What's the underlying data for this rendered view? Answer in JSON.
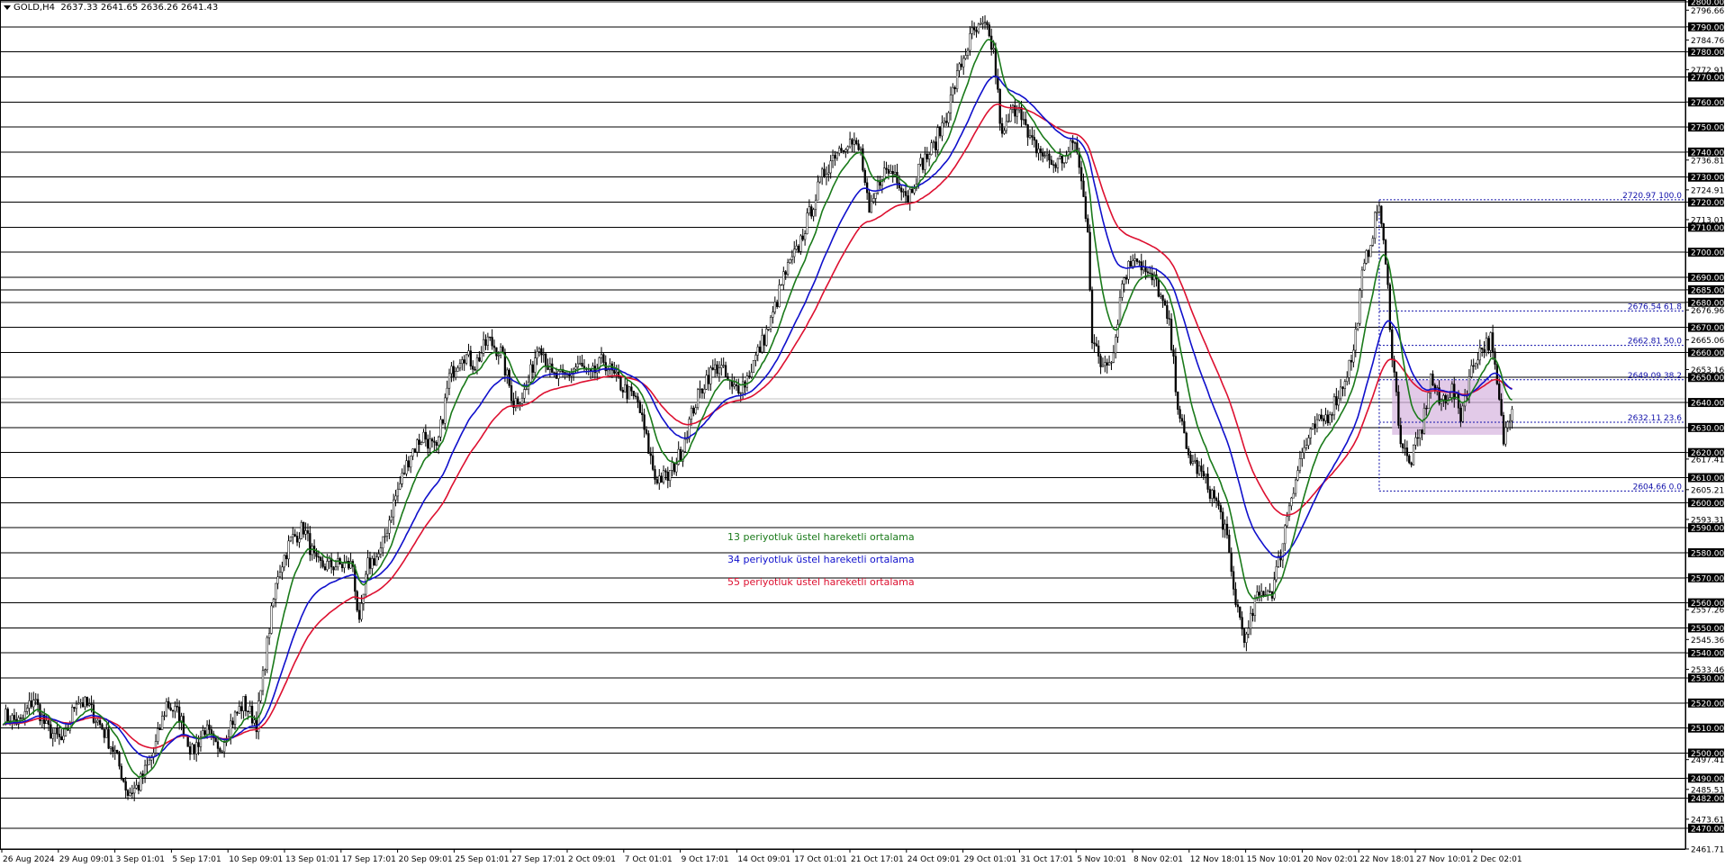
{
  "header": {
    "symbol": "GOLD,H4",
    "ohlc": "2637.33 2641.65 2636.26 2641.43"
  },
  "legend": [
    {
      "label": "13 periyotluk üstel hareketli ortalama",
      "color": "#1a7a1a"
    },
    {
      "label": "34 periyotluk üstel hareketli ortalama",
      "color": "#1010cc"
    },
    {
      "label": "55 periyotluk üstel hareketli ortalama",
      "color": "#dd1030"
    }
  ],
  "chart_data": {
    "type": "line",
    "title": "",
    "ylim": [
      2461.71,
      2800.0
    ],
    "grid": false,
    "x_ticks": [
      "26 Aug 2024",
      "29 Aug 09:01",
      "3 Sep 01:01",
      "5 Sep 17:01",
      "10 Sep 09:01",
      "13 Sep 01:01",
      "17 Sep 17:01",
      "20 Sep 09:01",
      "25 Sep 01:01",
      "27 Sep 17:01",
      "2 Oct 09:01",
      "7 Oct 01:01",
      "9 Oct 17:01",
      "14 Oct 09:01",
      "17 Oct 01:01",
      "21 Oct 17:01",
      "24 Oct 09:01",
      "29 Oct 01:01",
      "31 Oct 17:01",
      "5 Nov 10:01",
      "8 Nov 02:01",
      "12 Nov 18:01",
      "15 Nov 10:01",
      "20 Nov 02:01",
      "22 Nov 18:01",
      "27 Nov 10:01",
      "2 Dec 02:01"
    ],
    "horizontal_levels": [
      2800,
      2790,
      2780,
      2770,
      2760,
      2750,
      2740,
      2730,
      2720,
      2710,
      2700,
      2690,
      2685,
      2680,
      2670,
      2660,
      2650,
      2640,
      2630,
      2620,
      2610,
      2600,
      2590,
      2580,
      2570,
      2560,
      2550,
      2540,
      2530,
      2520,
      2510,
      2500,
      2490,
      2482,
      2470
    ],
    "y_tick_labels": [
      "2800.00",
      "2796.66",
      "2790.00",
      "2784.76",
      "2780.00",
      "2772.91",
      "2770.00",
      "2760.00",
      "2750.00",
      "2740.00",
      "2736.81",
      "2730.00",
      "2724.91",
      "2720.00",
      "2713.01",
      "2710.00",
      "2700.00",
      "2690.00",
      "2685.00",
      "2680.00",
      "2676.96",
      "2670.00",
      "2665.06",
      "2660.00",
      "2653.16",
      "2650.00",
      "2640.00",
      "2630.00",
      "2620.00",
      "2617.41",
      "2610.00",
      "2605.21",
      "2600.00",
      "2593.31",
      "2590.00",
      "2580.00",
      "2570.00",
      "2560.00",
      "2557.26",
      "2550.00",
      "2545.36",
      "2540.00",
      "2533.46",
      "2530.00",
      "2520.00",
      "2510.00",
      "2500.00",
      "2497.41",
      "2490.00",
      "2485.51",
      "2482.00",
      "2473.61",
      "2470.00",
      "2461.71"
    ],
    "highlighted_y_labels": [
      "2800.00",
      "2790.00",
      "2780.00",
      "2770.00",
      "2760.00",
      "2750.00",
      "2740.00",
      "2730.00",
      "2720.00",
      "2710.00",
      "2700.00",
      "2690.00",
      "2685.00",
      "2680.00",
      "2670.00",
      "2660.00",
      "2650.00",
      "2640.00",
      "2630.00",
      "2620.00",
      "2610.00",
      "2600.00",
      "2590.00",
      "2580.00",
      "2570.00",
      "2560.00",
      "2550.00",
      "2540.00",
      "2530.00",
      "2520.00",
      "2510.00",
      "2500.00",
      "2490.00",
      "2482.00",
      "2470.00"
    ],
    "current_price": 2641.43,
    "fibonacci": [
      {
        "label": "2720.97 100.0",
        "value": 2720.97
      },
      {
        "label": "2676.54 61.8",
        "value": 2676.54
      },
      {
        "label": "2662.81 50.0",
        "value": 2662.81
      },
      {
        "label": "2649.09 38.2",
        "value": 2649.09
      },
      {
        "label": "2632.11 23.6",
        "value": 2632.11
      },
      {
        "label": "2604.66 0.0",
        "value": 2604.66
      }
    ],
    "price_anchors": [
      [
        0,
        2515
      ],
      [
        8,
        2512
      ],
      [
        14,
        2522
      ],
      [
        20,
        2510
      ],
      [
        28,
        2504
      ],
      [
        34,
        2522
      ],
      [
        40,
        2518
      ],
      [
        46,
        2510
      ],
      [
        52,
        2500
      ],
      [
        58,
        2484
      ],
      [
        63,
        2487
      ],
      [
        70,
        2500
      ],
      [
        76,
        2520
      ],
      [
        82,
        2515
      ],
      [
        88,
        2500
      ],
      [
        94,
        2510
      ],
      [
        100,
        2500
      ],
      [
        106,
        2512
      ],
      [
        112,
        2520
      ],
      [
        118,
        2512
      ],
      [
        121,
        2530
      ],
      [
        124,
        2550
      ],
      [
        128,
        2572
      ],
      [
        134,
        2585
      ],
      [
        140,
        2590
      ],
      [
        146,
        2575
      ],
      [
        152,
        2575
      ],
      [
        158,
        2575
      ],
      [
        163,
        2575
      ],
      [
        166,
        2550
      ],
      [
        170,
        2575
      ],
      [
        176,
        2580
      ],
      [
        182,
        2600
      ],
      [
        190,
        2620
      ],
      [
        196,
        2627
      ],
      [
        202,
        2620
      ],
      [
        208,
        2650
      ],
      [
        214,
        2660
      ],
      [
        220,
        2655
      ],
      [
        226,
        2665
      ],
      [
        232,
        2660
      ],
      [
        238,
        2640
      ],
      [
        244,
        2645
      ],
      [
        250,
        2665
      ],
      [
        256,
        2650
      ],
      [
        262,
        2650
      ],
      [
        268,
        2655
      ],
      [
        274,
        2650
      ],
      [
        280,
        2657
      ],
      [
        285,
        2650
      ],
      [
        290,
        2645
      ],
      [
        296,
        2640
      ],
      [
        300,
        2625
      ],
      [
        304,
        2610
      ],
      [
        310,
        2610
      ],
      [
        316,
        2620
      ],
      [
        322,
        2638
      ],
      [
        328,
        2650
      ],
      [
        334,
        2655
      ],
      [
        340,
        2645
      ],
      [
        346,
        2648
      ],
      [
        352,
        2660
      ],
      [
        358,
        2672
      ],
      [
        364,
        2690
      ],
      [
        370,
        2700
      ],
      [
        376,
        2715
      ],
      [
        382,
        2730
      ],
      [
        388,
        2740
      ],
      [
        394,
        2745
      ],
      [
        400,
        2740
      ],
      [
        404,
        2714
      ],
      [
        410,
        2732
      ],
      [
        416,
        2732
      ],
      [
        422,
        2722
      ],
      [
        428,
        2735
      ],
      [
        434,
        2742
      ],
      [
        440,
        2755
      ],
      [
        446,
        2773
      ],
      [
        452,
        2787
      ],
      [
        458,
        2790
      ],
      [
        462,
        2780
      ],
      [
        466,
        2745
      ],
      [
        470,
        2755
      ],
      [
        474,
        2760
      ],
      [
        478,
        2745
      ],
      [
        484,
        2740
      ],
      [
        490,
        2735
      ],
      [
        496,
        2738
      ],
      [
        500,
        2745
      ],
      [
        506,
        2710
      ],
      [
        508,
        2665
      ],
      [
        512,
        2655
      ],
      [
        518,
        2660
      ],
      [
        522,
        2688
      ],
      [
        528,
        2700
      ],
      [
        534,
        2690
      ],
      [
        538,
        2688
      ],
      [
        544,
        2670
      ],
      [
        548,
        2640
      ],
      [
        552,
        2620
      ],
      [
        556,
        2615
      ],
      [
        560,
        2610
      ],
      [
        566,
        2600
      ],
      [
        570,
        2590
      ],
      [
        574,
        2565
      ],
      [
        578,
        2550
      ],
      [
        580,
        2545
      ],
      [
        584,
        2560
      ],
      [
        588,
        2565
      ],
      [
        592,
        2565
      ],
      [
        596,
        2580
      ],
      [
        600,
        2600
      ],
      [
        606,
        2620
      ],
      [
        612,
        2630
      ],
      [
        618,
        2635
      ],
      [
        624,
        2645
      ],
      [
        630,
        2660
      ],
      [
        634,
        2690
      ],
      [
        638,
        2705
      ],
      [
        642,
        2720
      ],
      [
        646,
        2685
      ],
      [
        648,
        2660
      ],
      [
        652,
        2625
      ],
      [
        656,
        2615
      ],
      [
        662,
        2630
      ],
      [
        666,
        2650
      ],
      [
        670,
        2640
      ],
      [
        676,
        2645
      ],
      [
        680,
        2635
      ],
      [
        684,
        2650
      ],
      [
        688,
        2660
      ],
      [
        694,
        2665
      ],
      [
        698,
        2640
      ],
      [
        700,
        2625
      ],
      [
        704,
        2640
      ]
    ],
    "bar_count": 705
  }
}
